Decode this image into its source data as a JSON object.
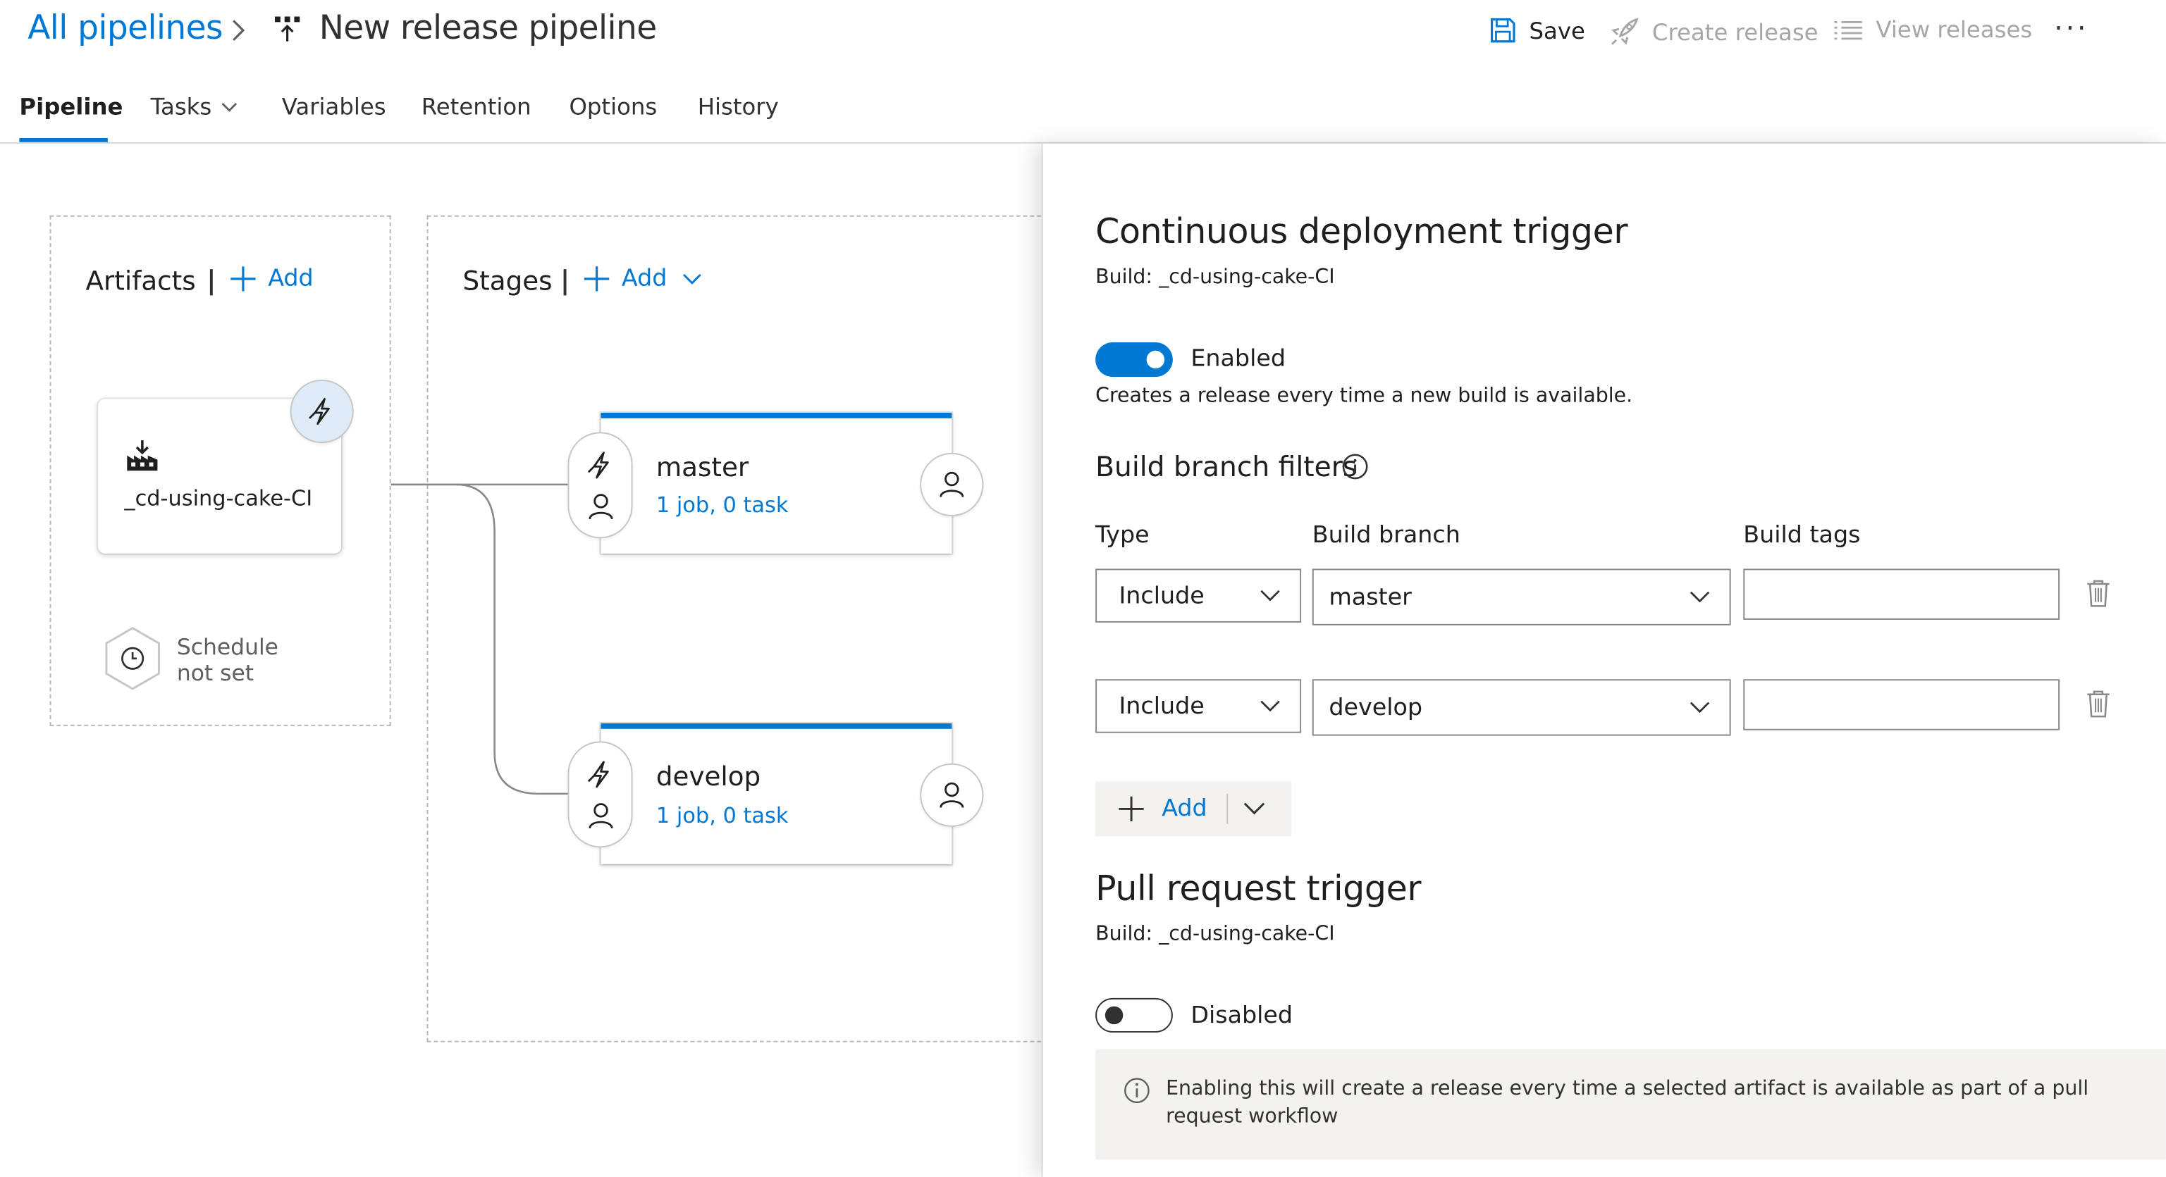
{
  "header": {
    "breadcrumb_root": "All pipelines",
    "pipeline_title": "New release pipeline",
    "actions": {
      "save": "Save",
      "create_release": "Create release",
      "view_releases": "View releases",
      "more": "···"
    }
  },
  "tabs": [
    {
      "label": "Pipeline",
      "active": true
    },
    {
      "label": "Tasks",
      "has_dropdown": true
    },
    {
      "label": "Variables"
    },
    {
      "label": "Retention"
    },
    {
      "label": "Options"
    },
    {
      "label": "History"
    }
  ],
  "artifacts": {
    "title": "Artifacts",
    "add_label": "Add",
    "artifact_name": "_cd-using-cake-CI",
    "schedule_line1": "Schedule",
    "schedule_line2": "not set"
  },
  "stages": {
    "title": "Stages",
    "add_label": "Add",
    "items": [
      {
        "name": "master",
        "summary": "1 job, 0 task"
      },
      {
        "name": "develop",
        "summary": "1 job, 0 task"
      }
    ]
  },
  "panel": {
    "title": "Continuous deployment trigger",
    "build_source": "Build: _cd-using-cake-CI",
    "toggle_label": "Enabled",
    "toggle_enabled": true,
    "description": "Creates a release every time a new build is available.",
    "filters_title": "Build branch filters",
    "columns": {
      "type": "Type",
      "branch": "Build branch",
      "tags": "Build tags"
    },
    "filters": [
      {
        "type": "Include",
        "branch": "master",
        "tags": ""
      },
      {
        "type": "Include",
        "branch": "develop",
        "tags": ""
      }
    ],
    "add_label": "Add",
    "pr_title": "Pull request trigger",
    "pr_build_source": "Build: _cd-using-cake-CI",
    "pr_toggle_label": "Disabled",
    "pr_toggle_enabled": false,
    "pr_info": "Enabling this will create a release every time a selected artifact is available as part of a pull request workflow"
  },
  "colors": {
    "accent": "#0078d4",
    "disabled_text": "#a6a6a6",
    "text": "#201f1e",
    "panel_info_bg": "#f3f2f1"
  },
  "icons": {
    "save": "save-icon",
    "create_release": "rocket-icon",
    "view_releases": "list-icon",
    "trigger": "lightning-icon",
    "approver": "person-icon",
    "schedule": "clock-icon",
    "artifact": "build-artifact-icon",
    "info": "info-icon",
    "delete": "trash-icon"
  }
}
